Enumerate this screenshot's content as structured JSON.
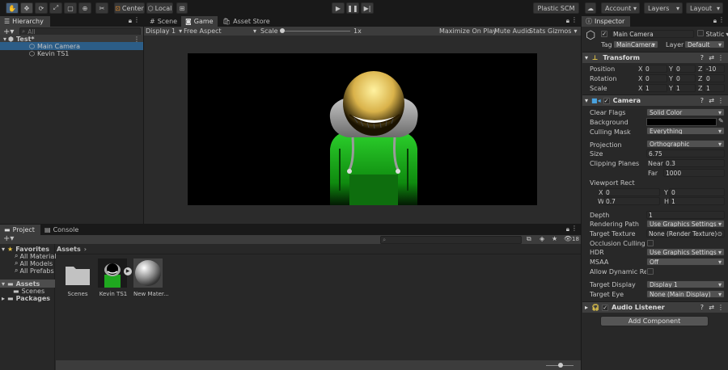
{
  "toolbar": {
    "center_label": "Center",
    "local_label": "Local",
    "plastic": "Plastic SCM",
    "account": "Account",
    "layers": "Layers",
    "layout": "Layout"
  },
  "hierarchy": {
    "title": "Hierarchy",
    "search": "All",
    "scene": "Test*",
    "items": [
      "Main Camera",
      "Kevin TS1"
    ]
  },
  "scene_tabs": {
    "scene": "Scene",
    "game": "Game",
    "asset_store": "Asset Store"
  },
  "game_bar": {
    "display": "Display 1",
    "aspect": "Free Aspect",
    "scale_label": "Scale",
    "scale_value": "1x",
    "maximize": "Maximize On Play",
    "mute": "Mute Audio",
    "stats": "Stats",
    "gizmos": "Gizmos"
  },
  "project": {
    "tab_project": "Project",
    "tab_console": "Console",
    "favorites": "Favorites",
    "fav_items": [
      "All Materials",
      "All Models",
      "All Prefabs"
    ],
    "assets": "Assets",
    "tree_items": [
      "Scenes"
    ],
    "packages": "Packages",
    "breadcrumb": "Assets",
    "count": "18",
    "files": [
      "Scenes",
      "Kevin TS1",
      "New Mater..."
    ]
  },
  "inspector": {
    "title": "Inspector",
    "object": "Main Camera",
    "static": "Static",
    "tag_label": "Tag",
    "tag": "MainCamera",
    "layer_label": "Layer",
    "layer": "Default",
    "transform": {
      "title": "Transform",
      "position": {
        "label": "Position",
        "x": "0",
        "y": "0",
        "z": "-10"
      },
      "rotation": {
        "label": "Rotation",
        "x": "0",
        "y": "0",
        "z": "0"
      },
      "scale": {
        "label": "Scale",
        "x": "1",
        "y": "1",
        "z": "1"
      }
    },
    "camera": {
      "title": "Camera",
      "clear_flags_label": "Clear Flags",
      "clear_flags": "Solid Color",
      "background_label": "Background",
      "culling_label": "Culling Mask",
      "culling": "Everything",
      "projection_label": "Projection",
      "projection": "Orthographic",
      "size_label": "Size",
      "size": "6.75",
      "clipping_label": "Clipping Planes",
      "near_label": "Near",
      "near": "0.3",
      "far_label": "Far",
      "far": "1000",
      "viewport_label": "Viewport Rect",
      "vx": "0",
      "vy": "0",
      "vw": "0.7",
      "vh": "1",
      "depth_label": "Depth",
      "depth": "1",
      "rendering_label": "Rendering Path",
      "rendering": "Use Graphics Settings",
      "target_tex_label": "Target Texture",
      "target_tex": "None (Render Texture)",
      "occlusion_label": "Occlusion Culling",
      "hdr_label": "HDR",
      "hdr": "Use Graphics Settings",
      "msaa_label": "MSAA",
      "msaa": "Off",
      "dyn_label": "Allow Dynamic Reso",
      "target_display_label": "Target Display",
      "target_display": "Display 1",
      "target_eye_label": "Target Eye",
      "target_eye": "None (Main Display)"
    },
    "audio": {
      "title": "Audio Listener"
    },
    "add_component": "Add Component"
  },
  "colors": {
    "accent": "#46607c",
    "bg": "#282828",
    "selected": "#2c5d87"
  }
}
